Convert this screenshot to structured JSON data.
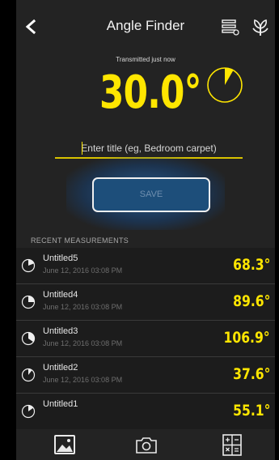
{
  "header": {
    "title": "Angle Finder"
  },
  "measurement": {
    "status": "Transmitted just now",
    "angle": "30.0°",
    "dial_fraction": 0.0833
  },
  "form": {
    "title_placeholder": "Enter title (eg, Bedroom carpet)",
    "save_label": "SAVE"
  },
  "recent": {
    "section_label": "RECENT MEASUREMENTS",
    "items": [
      {
        "name": "Untitled5",
        "date": "June 12, 2016 03:08 PM",
        "value": "68.3°"
      },
      {
        "name": "Untitled4",
        "date": "June 12, 2016 03:08 PM",
        "value": "89.6°"
      },
      {
        "name": "Untitled3",
        "date": "June 12, 2016 03:08 PM",
        "value": "106.9°"
      },
      {
        "name": "Untitled2",
        "date": "June 12, 2016 03:08 PM",
        "value": "37.6°"
      },
      {
        "name": "Untitled1",
        "date": "",
        "value": "55.1°"
      }
    ]
  },
  "colors": {
    "accent": "#ffe600",
    "background": "#232323",
    "button": "#1d4e7a"
  },
  "icons": {
    "back": "chevron-left-icon",
    "list": "list-icon",
    "plant": "plant-icon",
    "gallery": "image-icon",
    "camera": "camera-icon",
    "calculator": "calculator-icon"
  }
}
